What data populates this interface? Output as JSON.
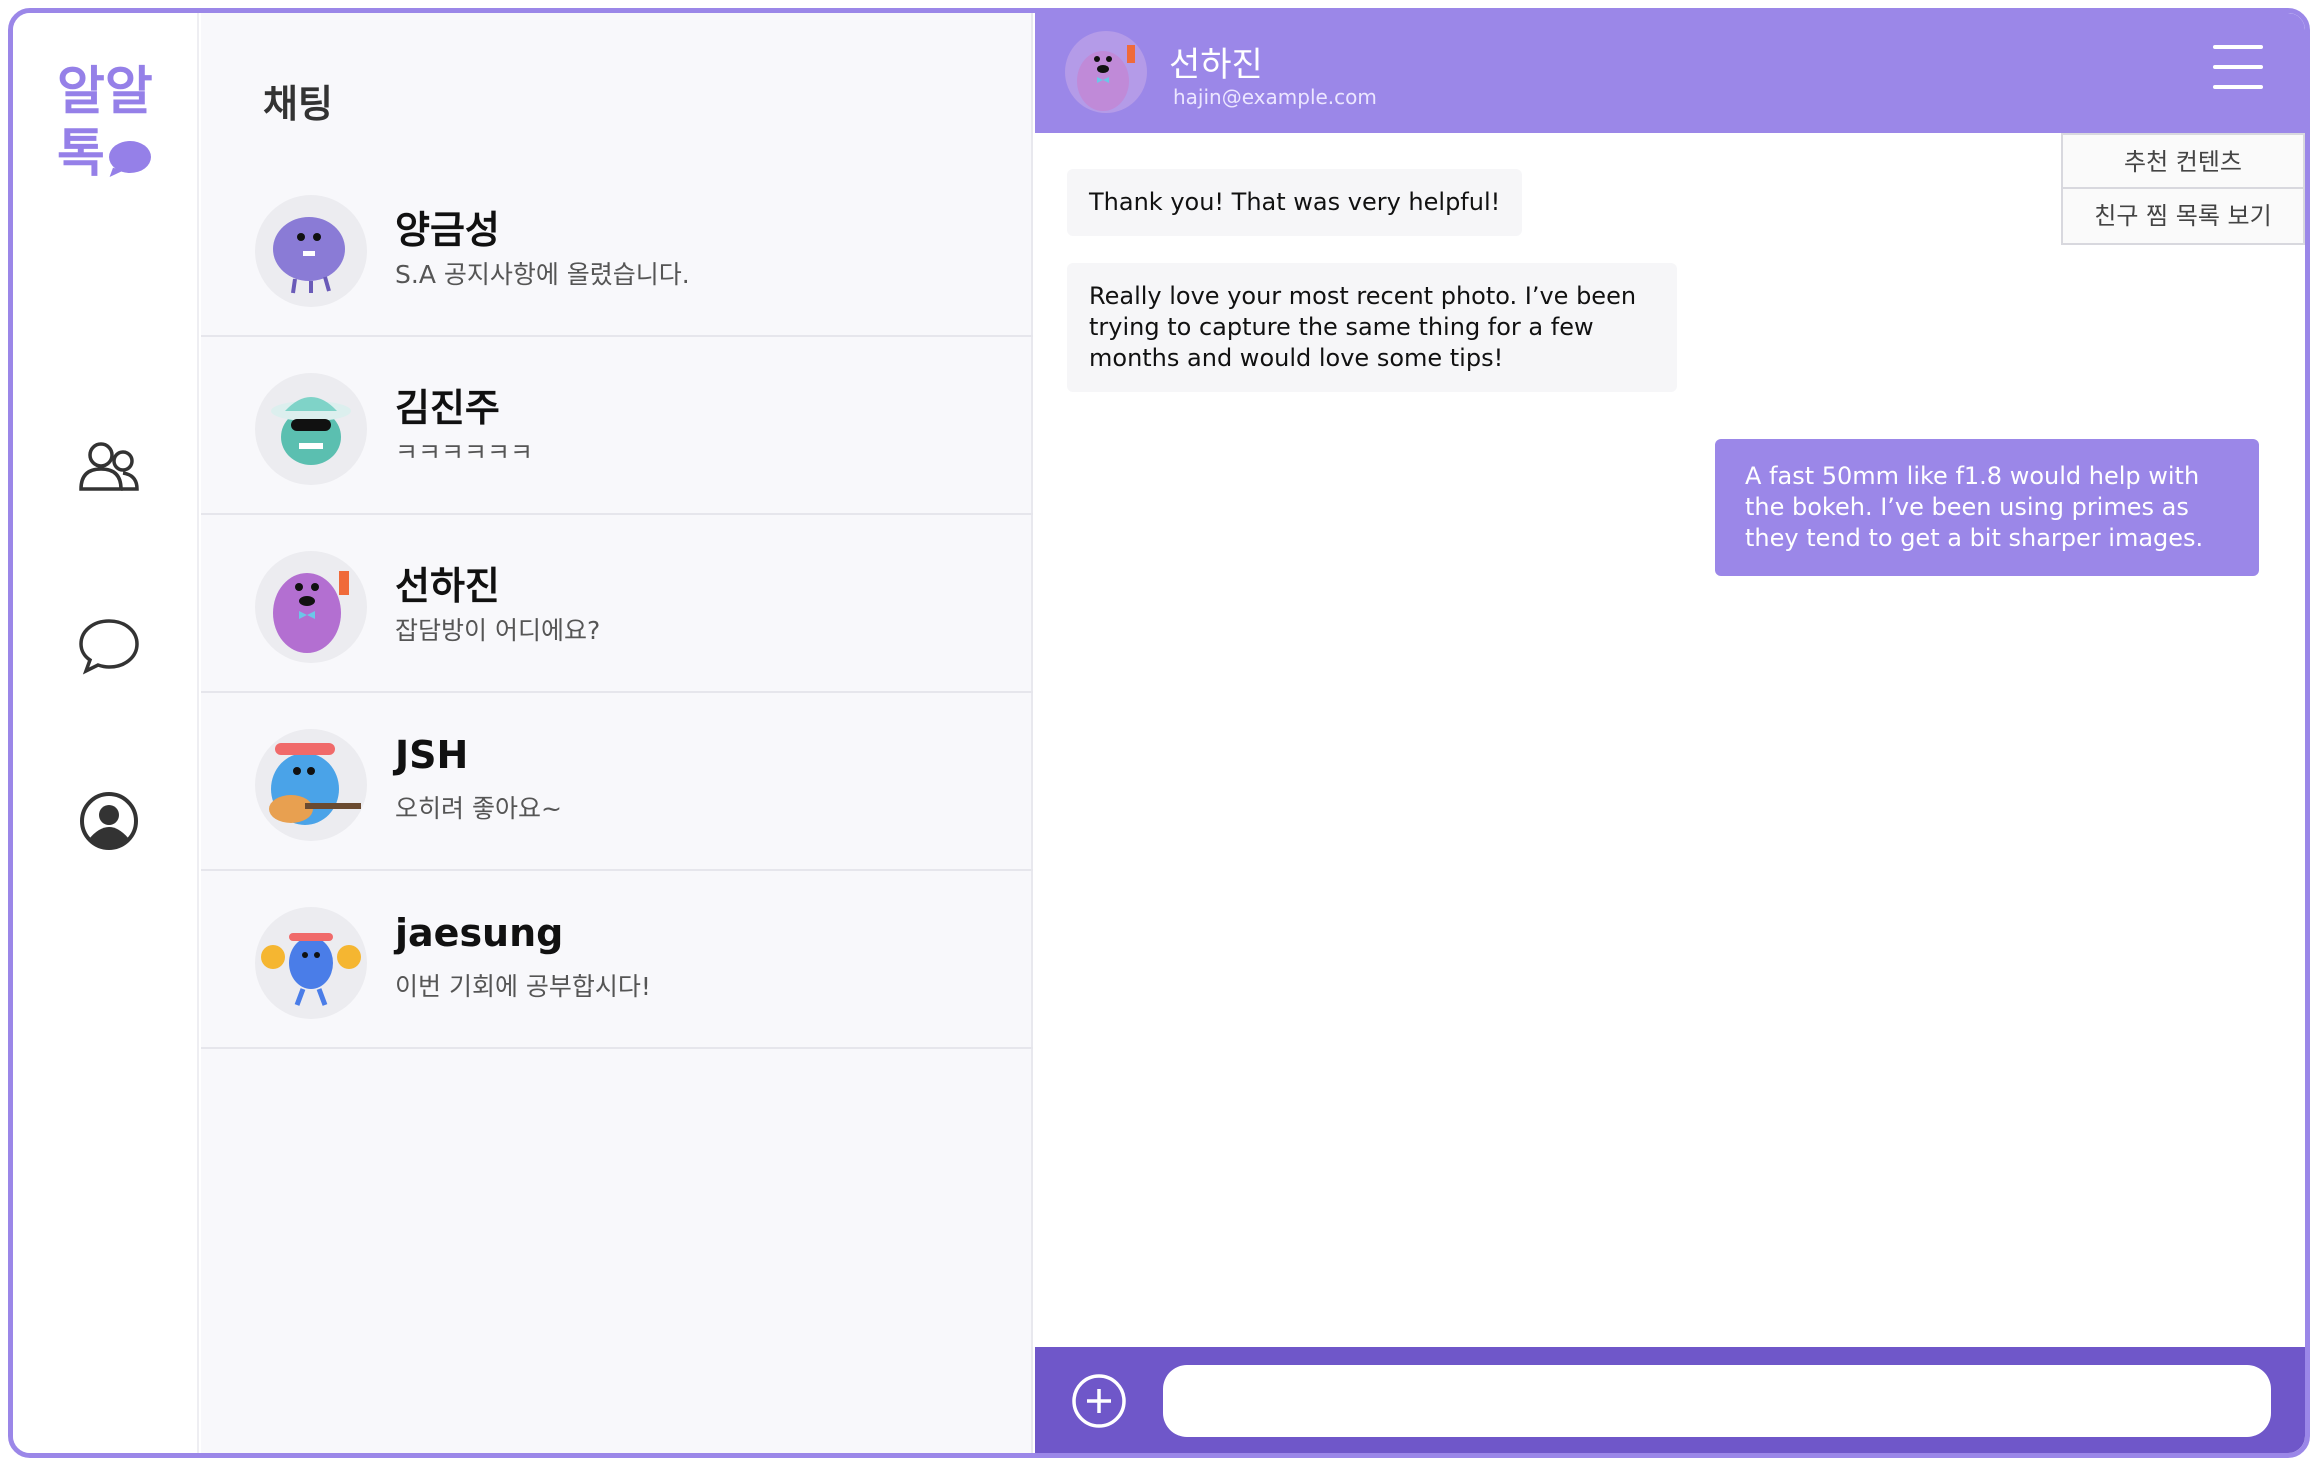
{
  "app": {
    "logo_line1": "알알",
    "logo_line2": "톡"
  },
  "nav": {
    "icons": [
      "friends-icon",
      "chat-icon",
      "profile-icon"
    ]
  },
  "list": {
    "title": "채팅",
    "chats": [
      {
        "name": "양금성",
        "preview": "S.A 공지사항에 올렸습니다."
      },
      {
        "name": "김진주",
        "preview": "ㅋㅋㅋㅋㅋㅋ"
      },
      {
        "name": "선하진",
        "preview": "잡담방이 어디에요?"
      },
      {
        "name": "JSH",
        "preview": "오히려 좋아요~"
      },
      {
        "name": "jaesung",
        "preview": "이번 기회에 공부합시다!"
      }
    ]
  },
  "conversation": {
    "name": "선하진",
    "email": "hajin@example.com",
    "menu": [
      "추천 컨텐츠",
      "친구 찜 목록 보기"
    ],
    "messages": [
      {
        "direction": "in",
        "text": "Thank you! That was very helpful!"
      },
      {
        "direction": "in",
        "text": "Really love your most recent photo. I’ve been trying to capture the same thing for a few months and would love some tips!"
      },
      {
        "direction": "out",
        "text": "A fast 50mm like f1.8 would help with the bokeh. I’ve been using primes as they tend to get a bit sharper images."
      }
    ],
    "input": {
      "value": "",
      "placeholder": ""
    }
  },
  "colors": {
    "accent": "#9b87e8",
    "composer": "#6f57c9",
    "list_bg": "#f8f8fb"
  }
}
